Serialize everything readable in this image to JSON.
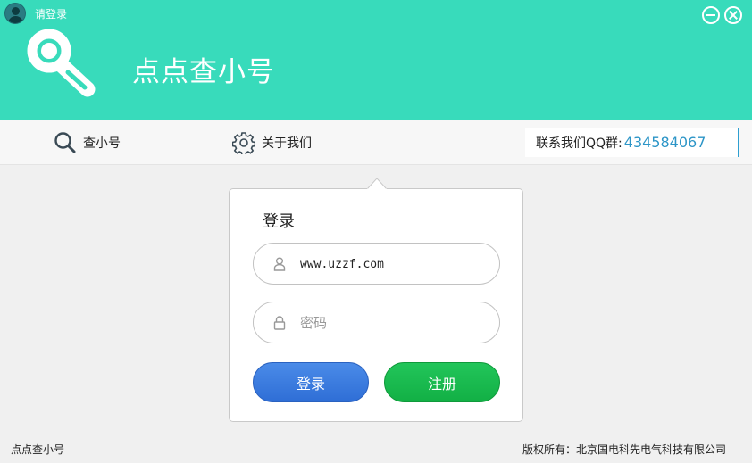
{
  "window": {
    "title": "请登录",
    "icons": {
      "avatar": "user-avatar-icon",
      "minimize": "minimize-icon",
      "close": "close-icon"
    }
  },
  "header": {
    "app_title": "点点查小号",
    "logo_icon": "magnifier-logo-icon",
    "background": "#38dbbb"
  },
  "nav": {
    "items": [
      {
        "label": "查小号",
        "icon": "search-icon"
      },
      {
        "label": "关于我们",
        "icon": "gear-icon"
      }
    ],
    "qq_label": "联系我们QQ群:",
    "qq_number": "434584067"
  },
  "login": {
    "heading": "登录",
    "username_value": "www.uzzf.com",
    "password_placeholder": "密码",
    "login_button": "登录",
    "register_button": "注册",
    "icons": {
      "user": "user-icon",
      "password": "lock-icon"
    },
    "colors": {
      "login_button": "#3a7ddf",
      "register_button": "#17b84c"
    }
  },
  "status": {
    "left": "点点查小号",
    "right": "版权所有：北京国电科先电气科技有限公司"
  }
}
